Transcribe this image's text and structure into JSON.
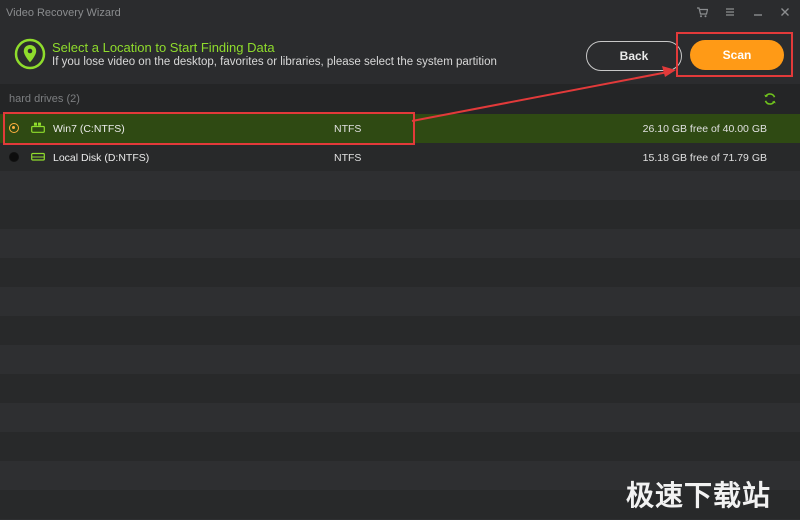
{
  "window": {
    "title": "Video Recovery Wizard"
  },
  "header": {
    "title": "Select a Location to Start Finding Data",
    "subtitle": "If you lose video on the desktop, favorites or libraries, please select the system partition",
    "back_label": "Back",
    "scan_label": "Scan",
    "accent_color": "#8fdc2c",
    "scan_color": "#ff9a16"
  },
  "section": {
    "label": "hard drives (2)"
  },
  "drives": [
    {
      "name": "Win7 (C:NTFS)",
      "fs": "NTFS",
      "space": "26.10 GB free of 40.00 GB",
      "selected": true
    },
    {
      "name": "Local Disk (D:NTFS)",
      "fs": "NTFS",
      "space": "15.18 GB free of 71.79 GB",
      "selected": false
    }
  ],
  "watermark": "极速下载站"
}
